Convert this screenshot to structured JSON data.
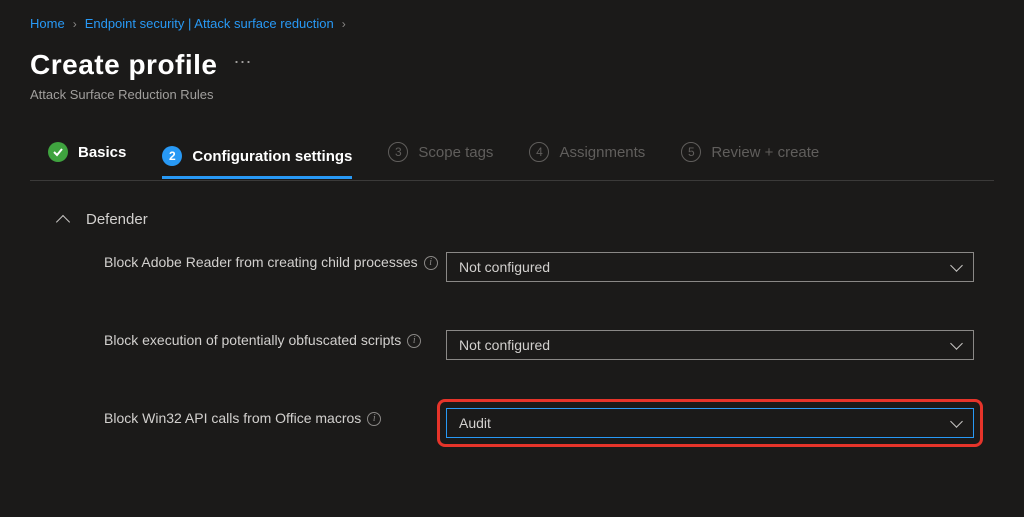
{
  "breadcrumb": {
    "items": [
      "Home",
      "Endpoint security | Attack surface reduction"
    ]
  },
  "page": {
    "title": "Create profile",
    "subtitle": "Attack Surface Reduction Rules"
  },
  "stepper": {
    "steps": [
      {
        "num": "",
        "label": "Basics"
      },
      {
        "num": "2",
        "label": "Configuration settings"
      },
      {
        "num": "3",
        "label": "Scope tags"
      },
      {
        "num": "4",
        "label": "Assignments"
      },
      {
        "num": "5",
        "label": "Review + create"
      }
    ]
  },
  "section": {
    "name": "Defender",
    "settings": [
      {
        "label": "Block Adobe Reader from creating child processes",
        "value": "Not configured"
      },
      {
        "label": "Block execution of potentially obfuscated scripts",
        "value": "Not configured"
      },
      {
        "label": "Block Win32 API calls from Office macros",
        "value": "Audit"
      }
    ]
  }
}
